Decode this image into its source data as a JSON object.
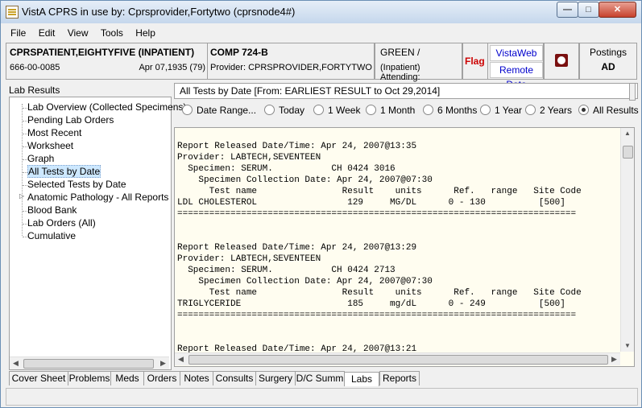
{
  "window": {
    "title": "VistA CPRS in use by: Cprsprovider,Fortytwo  (cprsnode4#)"
  },
  "menu": [
    "File",
    "Edit",
    "View",
    "Tools",
    "Help"
  ],
  "patient": {
    "name": "CPRSPATIENT,EIGHTYFIVE (INPATIENT)",
    "ssn": "666-00-0085",
    "dob": "Apr 07,1935 (79)"
  },
  "location": {
    "room": "COMP 724-B",
    "provider": "Provider:  CPRSPROVIDER,FORTYTWO"
  },
  "attending": {
    "team": "GREEN /",
    "label": "(Inpatient) Attending:"
  },
  "flag_label": "Flag",
  "vistaweb_label": "VistaWeb",
  "remote_data_label": "Remote Data",
  "postings": {
    "label": "Postings",
    "value": "AD"
  },
  "lab_panel_title": "Lab Results",
  "tree_items": [
    "Lab Overview (Collected Specimens)",
    "Pending Lab Orders",
    "Most Recent",
    "Worksheet",
    "Graph",
    "All Tests by Date",
    "Selected Tests by Date",
    "Anatomic Pathology - All Reports",
    "Blood Bank",
    "Lab Orders (All)",
    "Cumulative"
  ],
  "selected_tree_item": "All Tests by Date",
  "report_title": "All Tests by Date [From: EARLIEST RESULT to Oct 29,2014]",
  "date_ranges": [
    "Date Range...",
    "Today",
    "1 Week",
    "1 Month",
    "6 Months",
    "1 Year",
    "2 Years",
    "All Results"
  ],
  "selected_range": "All Results",
  "report_text": "\nReport Released Date/Time: Apr 24, 2007@13:35\nProvider: LABTECH,SEVENTEEN\n  Specimen: SERUM.           CH 0424 3016\n    Specimen Collection Date: Apr 24, 2007@07:30\n      Test name                Result    units      Ref.   range   Site Code\nLDL CHOLESTEROL                 129     MG/DL      0 - 130          [500]\n===========================================================================\n\n\nReport Released Date/Time: Apr 24, 2007@13:29\nProvider: LABTECH,SEVENTEEN\n  Specimen: SERUM.           CH 0424 2713\n    Specimen Collection Date: Apr 24, 2007@07:30\n      Test name                Result    units      Ref.   range   Site Code\nTRIGLYCERIDE                    185     mg/dL      0 - 249          [500]\n===========================================================================\n\n\nReport Released Date/Time: Apr 24, 2007@13:21",
  "tabs": [
    "Cover Sheet",
    "Problems",
    "Meds",
    "Orders",
    "Notes",
    "Consults",
    "Surgery",
    "D/C Summ",
    "Labs",
    "Reports"
  ],
  "active_tab": "Labs"
}
